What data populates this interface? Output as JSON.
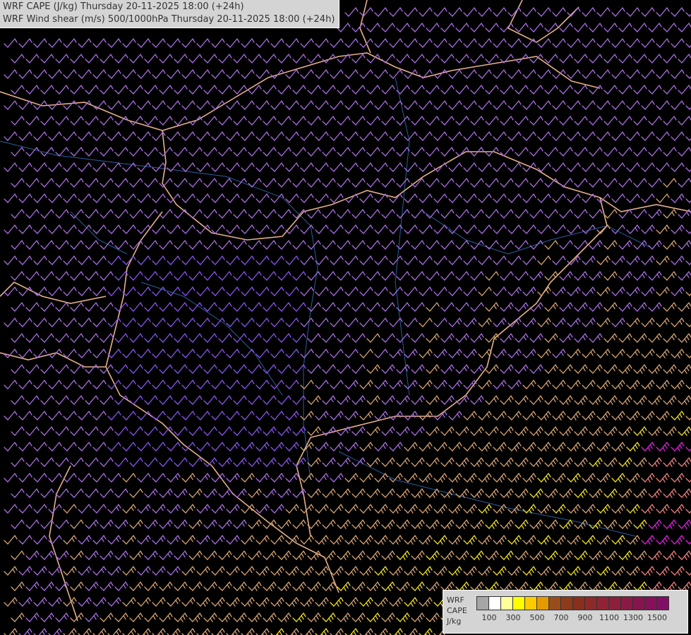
{
  "titles": [
    "WRF CAPE (J/kg) Thursday 20-11-2025 18:00 (+24h)",
    "WRF Wind shear (m/s) 500/1000hPa Thursday 20-11-2025 18:00 (+24h)"
  ],
  "legend": {
    "label_lines": [
      "WRF",
      "CAPE",
      "J/kg"
    ],
    "swatches": [
      "#a6a6a6",
      "#ffffff",
      "#ffff99",
      "#ffff00",
      "#ffcc00",
      "#e69900",
      "#994d1a",
      "#8c3c1a",
      "#8a2e1e",
      "#8c2a2a",
      "#8f2335",
      "#8c1f3c",
      "#8a1a45",
      "#87154d",
      "#851258",
      "#820f66"
    ],
    "ticks": [
      "100",
      "300",
      "500",
      "700",
      "900",
      "1100",
      "1300",
      "1500"
    ]
  },
  "colors": {
    "barb_violet": "#a86fe0",
    "barb_blue": "#8a55f0",
    "barb_tan": "#d4a373",
    "barb_yellow": "#f0e020",
    "barb_pink": "#f08080",
    "barb_magenta": "#e020e0",
    "border": "#e6b08a",
    "river": "#2a5fa0"
  }
}
